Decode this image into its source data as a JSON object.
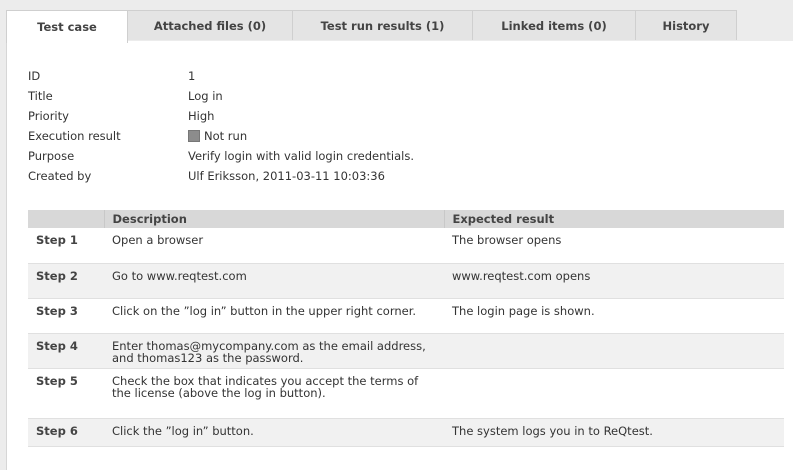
{
  "tabs": [
    {
      "label": "Test case",
      "active": true
    },
    {
      "label": "Attached files (0)",
      "active": false
    },
    {
      "label": "Test run results (1)",
      "active": false
    },
    {
      "label": "Linked items (0)",
      "active": false
    },
    {
      "label": "History",
      "active": false
    }
  ],
  "details": {
    "id": {
      "label": "ID",
      "value": "1"
    },
    "title": {
      "label": "Title",
      "value": "Log in"
    },
    "priority": {
      "label": "Priority",
      "value": "High"
    },
    "execution": {
      "label": "Execution result",
      "value": "Not run",
      "status_color": "#8c8c8c"
    },
    "purpose": {
      "label": "Purpose",
      "value": "Verify login with valid login credentials."
    },
    "created": {
      "label": "Created by",
      "value": "Ulf Eriksson, 2011-03-11 10:03:36"
    }
  },
  "steps_table": {
    "headers": [
      "",
      "Description",
      "Expected result"
    ],
    "rows": [
      {
        "step": "Step 1",
        "description": "Open a browser",
        "expected": "The browser opens"
      },
      {
        "step": "Step 2",
        "description": "Go to www.reqtest.com",
        "expected": "www.reqtest.com opens"
      },
      {
        "step": "Step 3",
        "description": "Click on the ”log in” button in the upper right corner.",
        "expected": "The login page is shown."
      },
      {
        "step": "Step 4",
        "description": "Enter thomas@mycompany.com as the email address, and thomas123 as the password.",
        "expected": ""
      },
      {
        "step": "Step 5",
        "description": "Check the box that indicates you accept the terms of the license (above the log in button).",
        "expected": ""
      },
      {
        "step": "Step 6",
        "description": "Click the ”log in” button.",
        "expected": "The system logs you in to ReQtest."
      }
    ]
  }
}
